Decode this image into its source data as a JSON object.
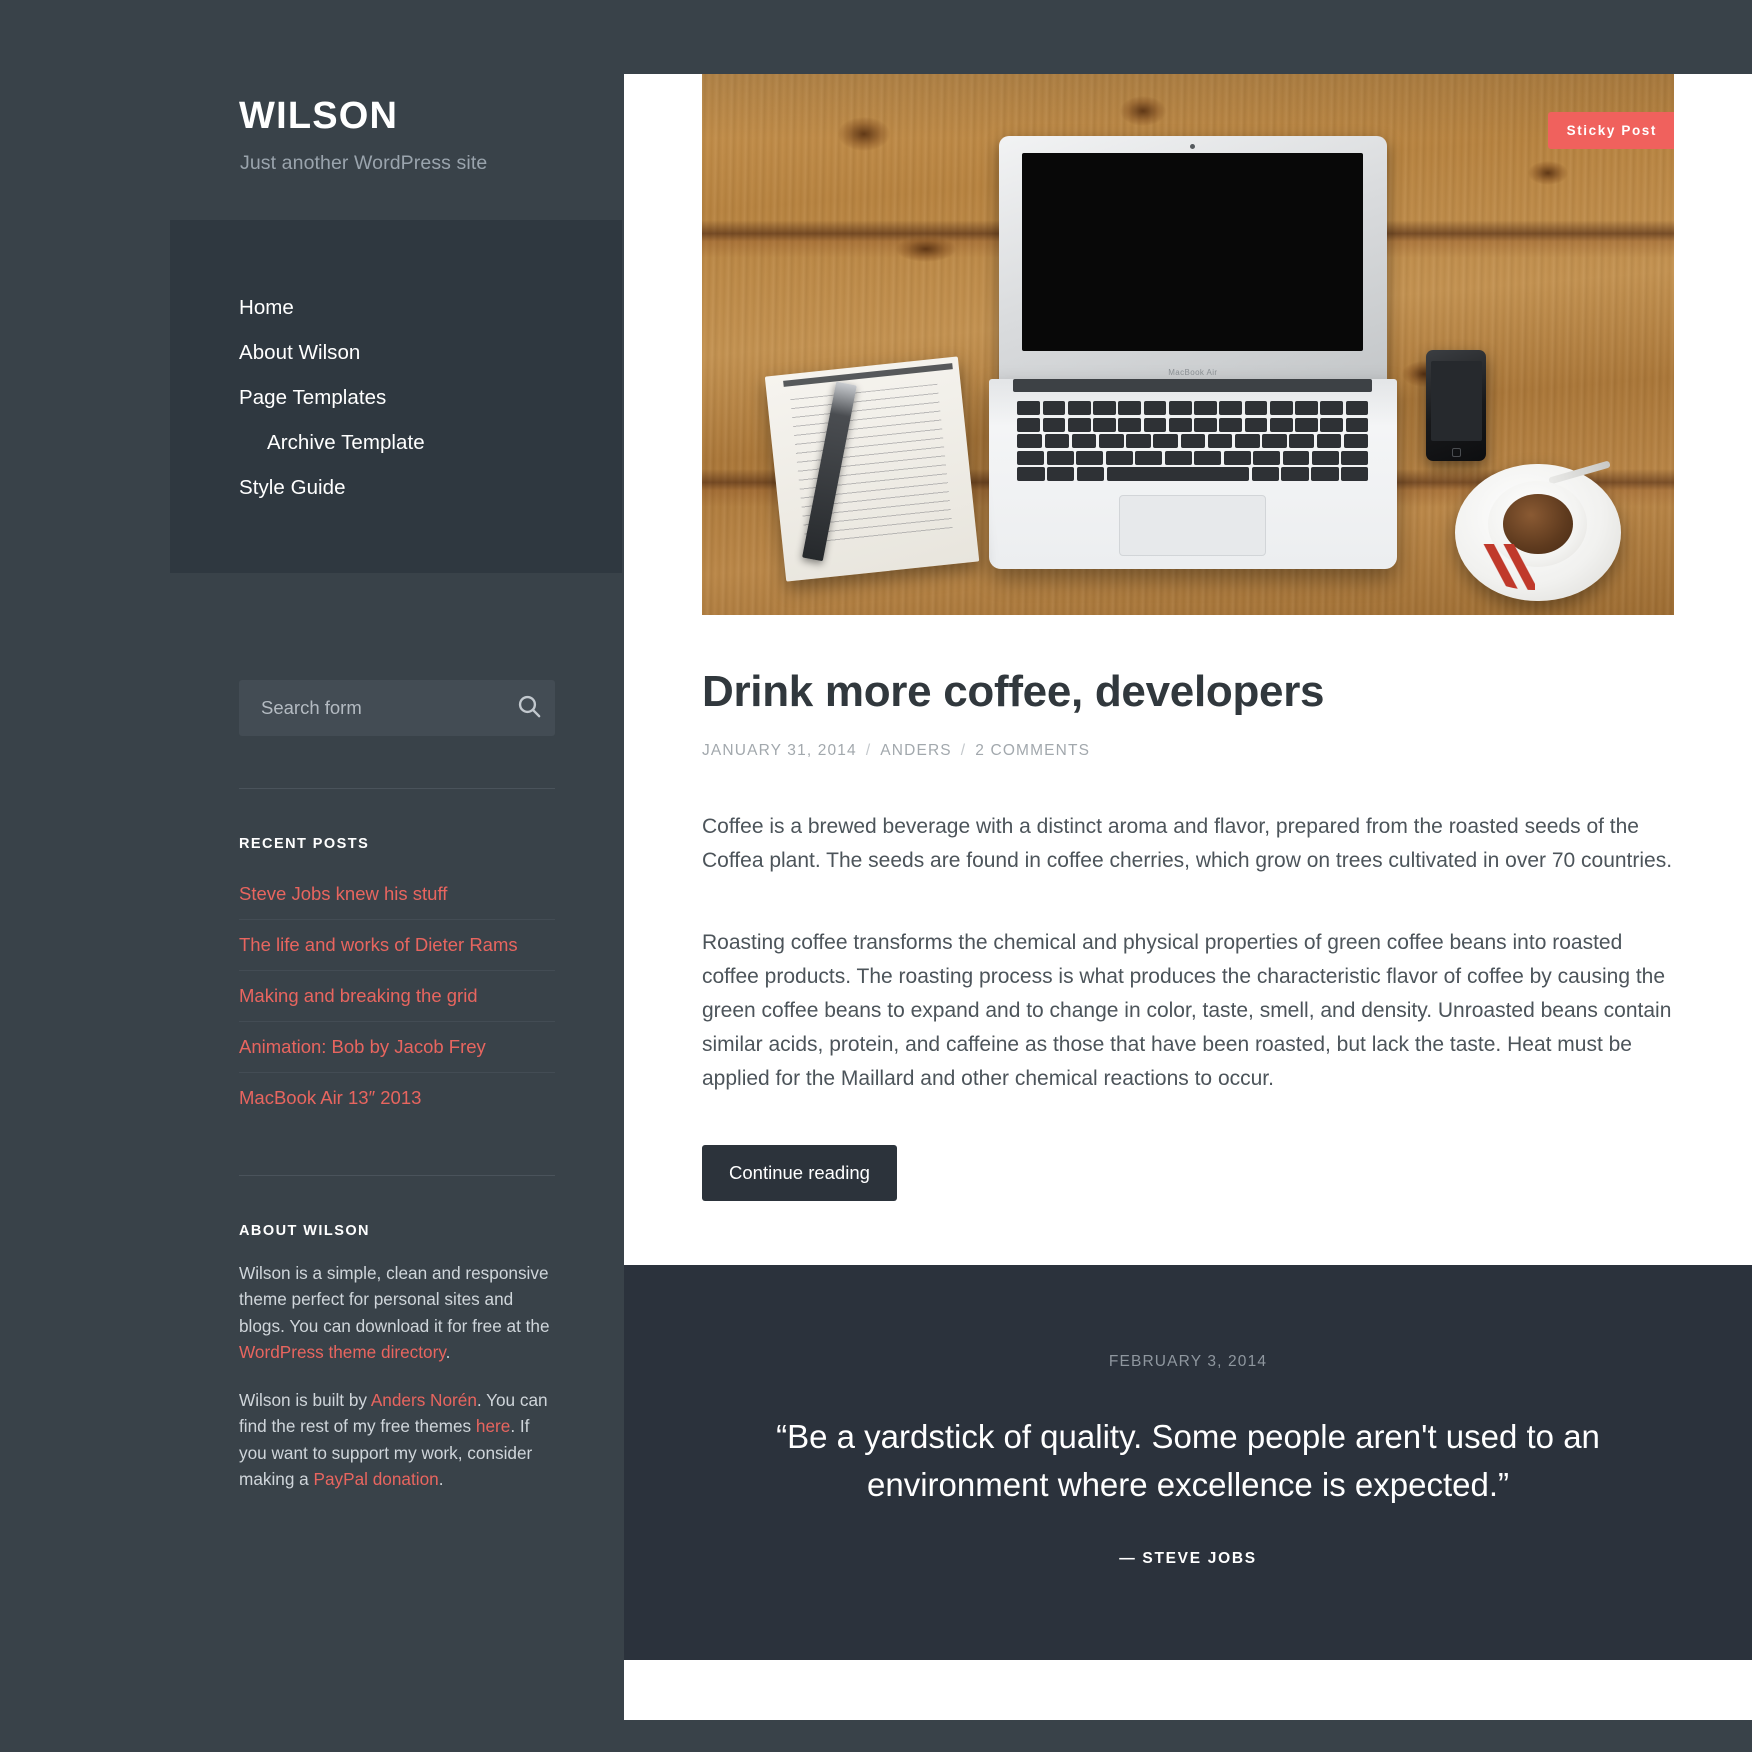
{
  "site": {
    "title": "WILSON",
    "tagline": "Just another WordPress site"
  },
  "nav": {
    "items": [
      {
        "label": "Home",
        "sub": false
      },
      {
        "label": "About Wilson",
        "sub": false
      },
      {
        "label": "Page Templates",
        "sub": false
      },
      {
        "label": "Archive Template",
        "sub": true
      },
      {
        "label": "Style Guide",
        "sub": false
      }
    ]
  },
  "search": {
    "placeholder": "Search form",
    "value": "",
    "icon": "search-icon"
  },
  "widgets": {
    "recent_posts": {
      "title": "Recent Posts",
      "items": [
        "Steve Jobs knew his stuff",
        "The life and works of Dieter Rams",
        "Making and breaking the grid",
        "Animation: Bob by Jacob Frey",
        "MacBook Air 13″ 2013"
      ]
    },
    "about": {
      "title": "About Wilson",
      "paragraph_1_before": "Wilson is a simple, clean and responsive theme perfect for personal sites and blogs. You can download it for free at the ",
      "paragraph_1_link": "WordPress theme directory",
      "paragraph_1_after": ".",
      "paragraph_2_a": "Wilson is built by ",
      "paragraph_2_link_1": "Anders Norén",
      "paragraph_2_b": ". You can find the rest of my free themes ",
      "paragraph_2_link_2": "here",
      "paragraph_2_c": ". If you want to support my work, consider making a ",
      "paragraph_2_link_3": "PayPal donation",
      "paragraph_2_d": "."
    }
  },
  "posts": [
    {
      "badge": "Sticky Post",
      "featured_image_alt": "MacBook Air, notebook with pen, iPhone and a cup of coffee on a wooden desk",
      "title": "Drink more coffee, developers",
      "meta": {
        "date": "January 31, 2014",
        "author": "Anders",
        "comments": "2 Comments",
        "separator": "/"
      },
      "paragraphs": [
        "Coffee is a brewed beverage with a distinct aroma and flavor, prepared from the roasted seeds of the Coffea plant. The seeds are found in coffee cherries, which grow on trees cultivated in over 70 countries.",
        "Roasting coffee transforms the chemical and physical properties of green coffee beans into roasted coffee products. The roasting process is what produces the characteristic flavor of coffee by causing the green coffee beans to expand and to change in color, taste, smell, and density. Unroasted beans contain similar acids, protein, and caffeine as those that have been roasted, but lack the taste. Heat must be applied for the Maillard and other chemical reactions to occur."
      ],
      "continue_label": "Continue reading"
    }
  ],
  "quote_post": {
    "date": "February 3, 2014",
    "text": "“Be a yardstick of quality. Some people aren't used to an environment where excellence is expected.”",
    "cite": "— Steve Jobs"
  },
  "colors": {
    "background": "#394249",
    "nav_panel": "#2f3840",
    "accent": "#e8655f",
    "badge": "#f0615d",
    "quote_panel": "#2b323c",
    "button": "#2c333b"
  }
}
